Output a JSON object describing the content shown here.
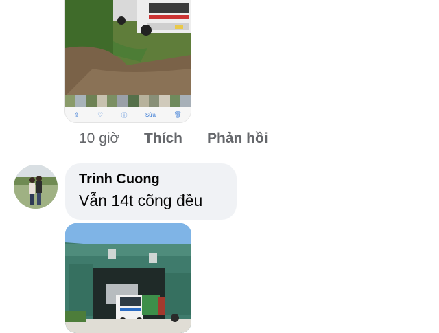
{
  "post_photo": {
    "alt": "photo of truck parked on dirt road",
    "gallery_bar": {
      "share_icon": "share-icon",
      "heart_icon": "heart-icon",
      "info_icon": "info-icon",
      "edit_label": "Sửa",
      "trash_icon": "trash-icon"
    }
  },
  "actions": {
    "time": "10 giờ",
    "like": "Thích",
    "reply": "Phản hồi"
  },
  "comment": {
    "author": "Trinh Cuong",
    "text": "Vẫn 14t cõng đều"
  },
  "comment_photo": {
    "alt": "photo of truck inside warehouse"
  }
}
